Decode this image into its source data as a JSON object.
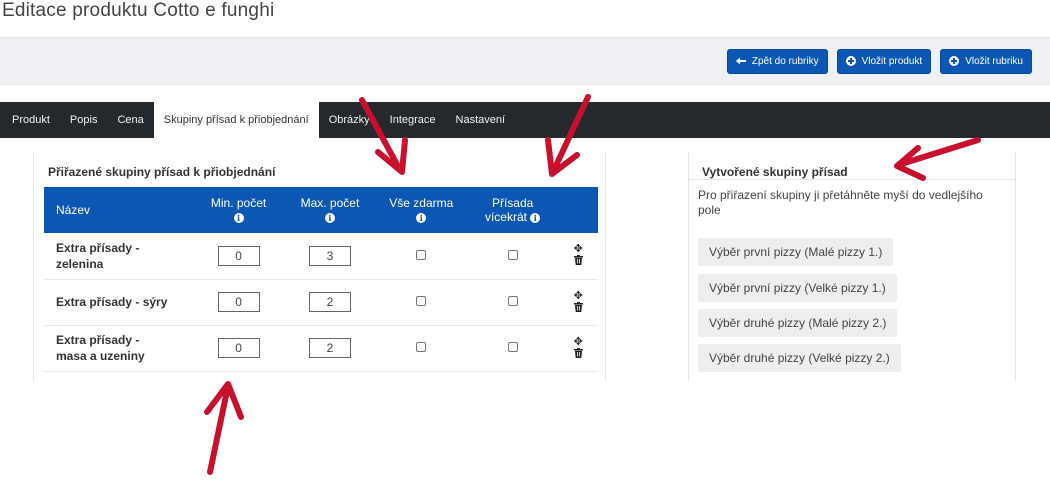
{
  "page": {
    "title": "Editace produktu Cotto e funghi"
  },
  "toolbar": {
    "back_label": "Zpět do rubriky",
    "add_product_label": "Vložit produkt",
    "add_category_label": "Vložit rubriku"
  },
  "tabs": [
    {
      "label": "Produkt"
    },
    {
      "label": "Popis"
    },
    {
      "label": "Cena"
    },
    {
      "label": "Skupiny přísad k přiobjednání",
      "active": true
    },
    {
      "label": "Obrázky"
    },
    {
      "label": "Integrace"
    },
    {
      "label": "Nastavení"
    }
  ],
  "assigned": {
    "heading": "Přiřazené skupiny přísad k přiobjednání",
    "columns": {
      "name": "Název",
      "min": "Min. počet",
      "max": "Max. počet",
      "free": "Vše zdarma",
      "multi_line1": "Přísada",
      "multi_line2": "vícekrát"
    },
    "rows": [
      {
        "name_line1": "Extra přísady -",
        "name_line2": "zelenina",
        "min": "0",
        "max": "3",
        "free": false,
        "multi": false
      },
      {
        "name_line1": "Extra přísady - sýry",
        "name_line2": "",
        "min": "0",
        "max": "2",
        "free": false,
        "multi": false
      },
      {
        "name_line1": "Extra přísady -",
        "name_line2": "masa a uzeniny",
        "min": "0",
        "max": "2",
        "free": false,
        "multi": false
      }
    ]
  },
  "created": {
    "heading": "Vytvořené skupiny přísad",
    "hint": "Pro přiřazení skupiny ji přetáhněte myší do vedlejšího pole",
    "groups": [
      {
        "label": "Výběr první pizzy (Malé pizzy 1.)"
      },
      {
        "label": "Výběr první pizzy (Velké pizzy 1.)"
      },
      {
        "label": "Výběr druhé pizzy (Malé pizzy 2.)"
      },
      {
        "label": "Výběr druhé pizzy (Velké pizzy 2.)"
      }
    ]
  },
  "icons": {
    "info": "info-icon",
    "move": "move-icon",
    "delete": "trash-icon"
  },
  "colors": {
    "primary": "#0b57b3",
    "tabbar": "#25282c",
    "annotation_arrow": "#c8102e"
  }
}
